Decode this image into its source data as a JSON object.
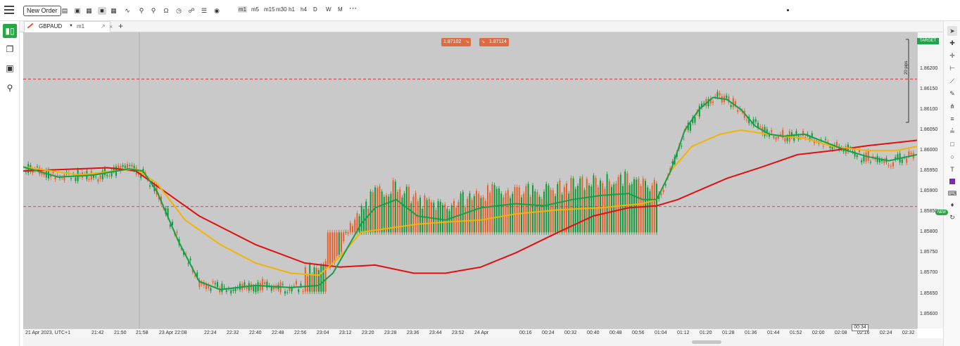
{
  "toolbar": {
    "new_order_label": "New Order",
    "timeframes": [
      "m1",
      "m5",
      "m15",
      "m30",
      "h1",
      "h4",
      "D",
      "W",
      "M"
    ],
    "more_label": "⋯"
  },
  "tab": {
    "symbol": "GBPAUD",
    "timeframe": "m1",
    "close_glyph": "×",
    "add_glyph": "+"
  },
  "price_buttons": {
    "sell": "1.87102",
    "buy": "1.87114"
  },
  "target_label": "TARGET",
  "pips_label": "20 pips",
  "new_badge": "NEW",
  "current_time_badge": "00:34",
  "colors": {
    "chart_bg": "#c9c9c9",
    "up_candle": "#119a3a",
    "down_candle": "#e8612c",
    "ma_red": "#e01010",
    "ma_yellow": "#f2b400",
    "ma_green": "#14a04a",
    "hline": "#e02020"
  },
  "chart_data": {
    "type": "candlestick",
    "symbol": "GBPAUD",
    "price_ticks": [
      "1.86200",
      "1.86150",
      "1.86100",
      "1.86050",
      "1.86000",
      "1.85950",
      "1.85900",
      "1.85850",
      "1.85800",
      "1.85750",
      "1.85700",
      "1.85650",
      "1.85600"
    ],
    "ylim": [
      1.85565,
      1.86289
    ],
    "time_ticks": [
      "21 Apr 2023, UTC+1",
      "21:42",
      "21:50",
      "21:58",
      "23 Apr 22:08",
      "22:24",
      "22:32",
      "22:40",
      "22:48",
      "22:56",
      "23:04",
      "23:12",
      "23:20",
      "23:28",
      "23:36",
      "23:44",
      "23:52",
      "24 Apr",
      "00:16",
      "00:24",
      "00:32",
      "00:40",
      "00:48",
      "00:56",
      "01:04",
      "01:12",
      "01:20",
      "01:28",
      "01:36",
      "01:44",
      "01:52",
      "02:00",
      "02:08",
      "02:16",
      "02:24",
      "02:32"
    ],
    "horizontal_levels": [
      1.86175,
      1.85863
    ],
    "moving_averages": [
      {
        "color": "red",
        "points": [
          [
            0,
            1.8595
          ],
          [
            120,
            1.85958
          ],
          [
            160,
            1.8595
          ],
          [
            250,
            1.8584
          ],
          [
            330,
            1.8577
          ],
          [
            400,
            1.85725
          ],
          [
            450,
            1.85715
          ],
          [
            500,
            1.8572
          ],
          [
            555,
            1.857
          ],
          [
            600,
            1.857
          ],
          [
            650,
            1.85715
          ],
          [
            700,
            1.8575
          ],
          [
            760,
            1.858
          ],
          [
            810,
            1.8584
          ],
          [
            860,
            1.8586
          ],
          [
            900,
            1.85865
          ],
          [
            930,
            1.8588
          ],
          [
            970,
            1.8591
          ],
          [
            1000,
            1.85932
          ],
          [
            1050,
            1.8596
          ],
          [
            1100,
            1.8599
          ],
          [
            1150,
            1.86
          ],
          [
            1200,
            1.86012
          ],
          [
            1270,
            1.86025
          ]
        ]
      },
      {
        "color": "yellow",
        "points": [
          [
            0,
            1.8596
          ],
          [
            80,
            1.8594
          ],
          [
            130,
            1.8595
          ],
          [
            160,
            1.85955
          ],
          [
            190,
            1.8592
          ],
          [
            230,
            1.8583
          ],
          [
            280,
            1.8577
          ],
          [
            330,
            1.85725
          ],
          [
            380,
            1.857
          ],
          [
            420,
            1.85695
          ],
          [
            450,
            1.8574
          ],
          [
            480,
            1.858
          ],
          [
            520,
            1.8581
          ],
          [
            560,
            1.8582
          ],
          [
            600,
            1.85825
          ],
          [
            650,
            1.8583
          ],
          [
            700,
            1.85845
          ],
          [
            760,
            1.85855
          ],
          [
            820,
            1.8586
          ],
          [
            880,
            1.8587
          ],
          [
            900,
            1.8588
          ],
          [
            920,
            1.8595
          ],
          [
            950,
            1.8601
          ],
          [
            990,
            1.8604
          ],
          [
            1020,
            1.8605
          ],
          [
            1050,
            1.86042
          ],
          [
            1080,
            1.86035
          ],
          [
            1110,
            1.8603
          ],
          [
            1150,
            1.8601
          ],
          [
            1200,
            1.86
          ],
          [
            1240,
            1.86
          ],
          [
            1270,
            1.8601
          ]
        ]
      },
      {
        "color": "green",
        "points": [
          [
            0,
            1.8596
          ],
          [
            50,
            1.85935
          ],
          [
            100,
            1.8594
          ],
          [
            150,
            1.85955
          ],
          [
            170,
            1.8595
          ],
          [
            190,
            1.859
          ],
          [
            220,
            1.8578
          ],
          [
            250,
            1.8568
          ],
          [
            280,
            1.8566
          ],
          [
            330,
            1.8567
          ],
          [
            380,
            1.85665
          ],
          [
            420,
            1.8567
          ],
          [
            440,
            1.857
          ],
          [
            460,
            1.8576
          ],
          [
            480,
            1.8582
          ],
          [
            500,
            1.8586
          ],
          [
            530,
            1.8588
          ],
          [
            560,
            1.8584
          ],
          [
            600,
            1.8583
          ],
          [
            650,
            1.8586
          ],
          [
            700,
            1.8587
          ],
          [
            740,
            1.85865
          ],
          [
            780,
            1.8588
          ],
          [
            820,
            1.8589
          ],
          [
            860,
            1.85895
          ],
          [
            880,
            1.8588
          ],
          [
            900,
            1.8588
          ],
          [
            920,
            1.8595
          ],
          [
            940,
            1.8605
          ],
          [
            960,
            1.861
          ],
          [
            980,
            1.8613
          ],
          [
            1000,
            1.86125
          ],
          [
            1020,
            1.861
          ],
          [
            1040,
            1.8606
          ],
          [
            1060,
            1.8604
          ],
          [
            1080,
            1.86035
          ],
          [
            1110,
            1.8604
          ],
          [
            1140,
            1.8602
          ],
          [
            1170,
            1.86
          ],
          [
            1200,
            1.85985
          ],
          [
            1230,
            1.85975
          ],
          [
            1270,
            1.8599
          ]
        ]
      }
    ]
  }
}
